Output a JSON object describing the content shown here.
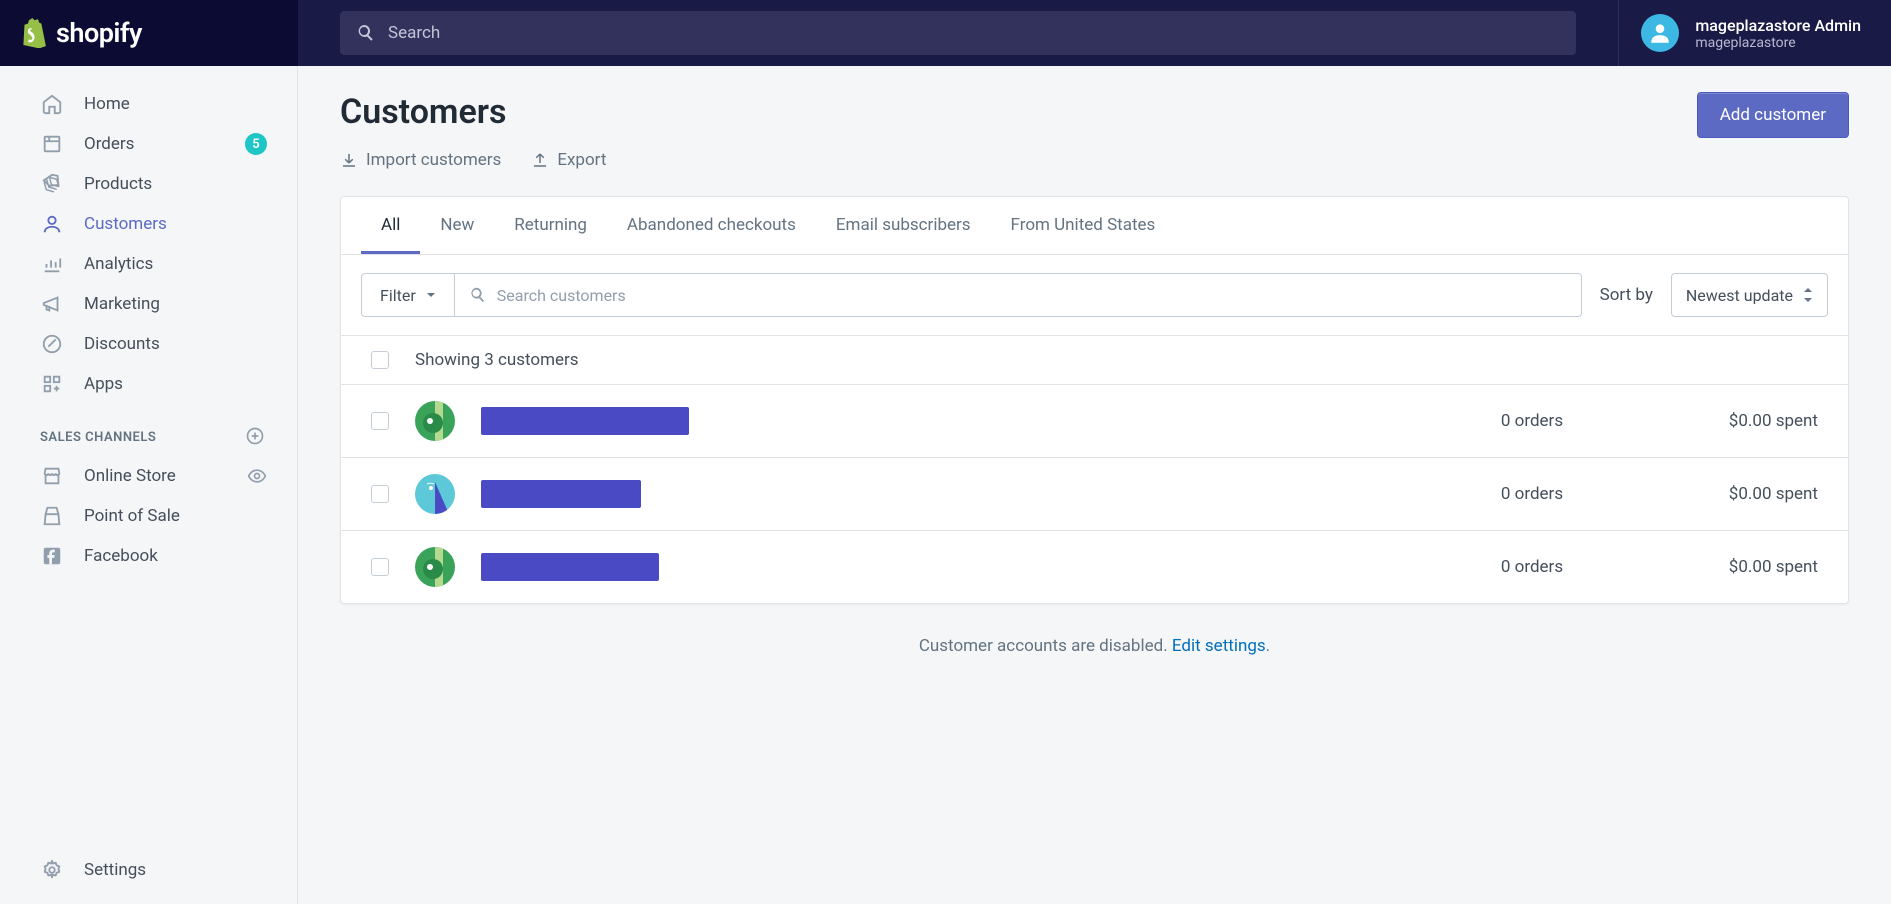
{
  "header": {
    "search_placeholder": "Search",
    "user_name": "mageplazastore Admin",
    "store_name": "mageplazastore",
    "logo_text": "shopify"
  },
  "sidebar": {
    "items": [
      {
        "label": "Home"
      },
      {
        "label": "Orders",
        "badge": "5"
      },
      {
        "label": "Products"
      },
      {
        "label": "Customers"
      },
      {
        "label": "Analytics"
      },
      {
        "label": "Marketing"
      },
      {
        "label": "Discounts"
      },
      {
        "label": "Apps"
      }
    ],
    "section_title": "SALES CHANNELS",
    "channels": [
      {
        "label": "Online Store"
      },
      {
        "label": "Point of Sale"
      },
      {
        "label": "Facebook"
      }
    ],
    "settings": "Settings"
  },
  "page": {
    "title": "Customers",
    "import_label": "Import customers",
    "export_label": "Export",
    "add_button": "Add customer"
  },
  "tabs": [
    "All",
    "New",
    "Returning",
    "Abandoned checkouts",
    "Email subscribers",
    "From United States"
  ],
  "filters": {
    "filter_label": "Filter",
    "search_placeholder": "Search customers",
    "sort_by_label": "Sort by",
    "sort_value": "Newest update"
  },
  "table": {
    "showing": "Showing 3 customers",
    "rows": [
      {
        "name_width": 208,
        "orders": "0 orders",
        "spent": "$0.00 spent",
        "avatar_bg": "#3aa35a",
        "avatar_accent": "#b5d98e"
      },
      {
        "name_width": 160,
        "orders": "0 orders",
        "spent": "$0.00 spent",
        "avatar_bg": "#5cc8d8",
        "avatar_accent": "#4a4ac4"
      },
      {
        "name_width": 178,
        "orders": "0 orders",
        "spent": "$0.00 spent",
        "avatar_bg": "#3aa35a",
        "avatar_accent": "#b5d98e"
      }
    ]
  },
  "footer": {
    "text": "Customer accounts are disabled. ",
    "link": "Edit settings",
    "period": "."
  }
}
